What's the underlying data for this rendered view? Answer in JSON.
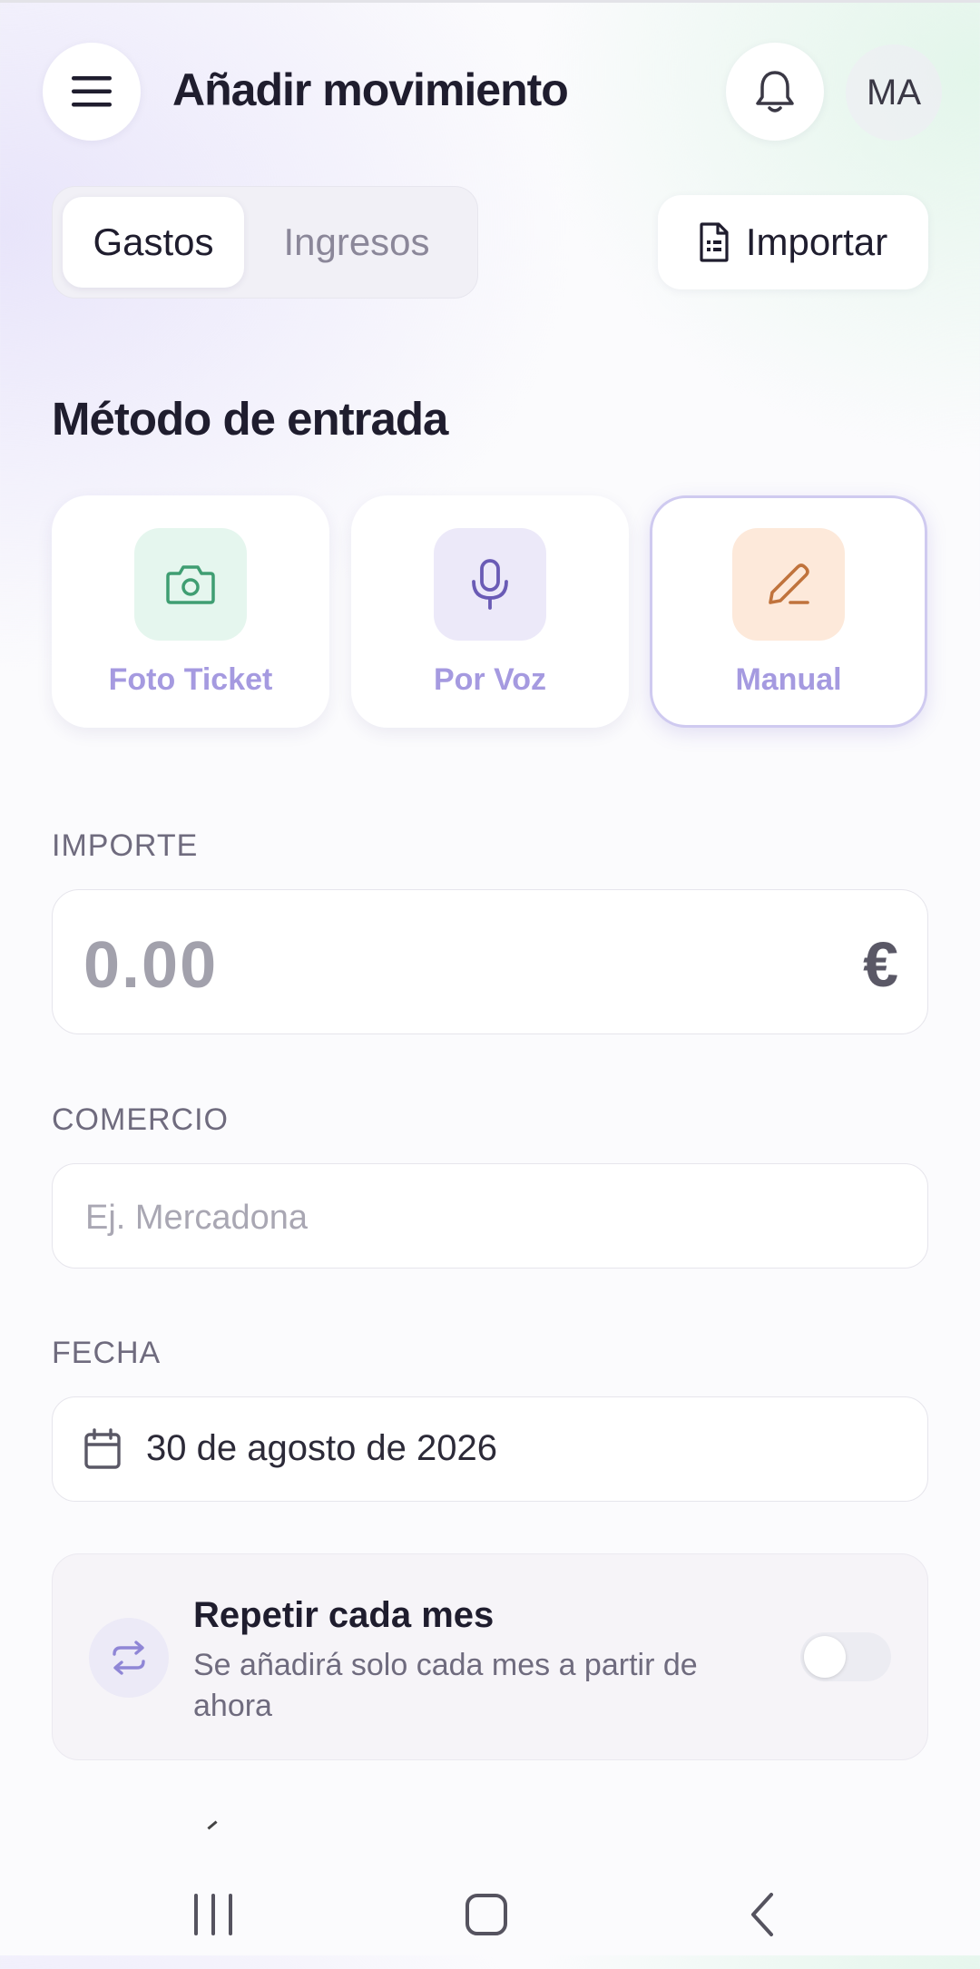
{
  "header": {
    "title": "Añadir movimiento",
    "avatar_initials": "MA",
    "menu_icon": "hamburger-menu-icon",
    "notification_icon": "bell-icon"
  },
  "type_toggle": {
    "options": [
      "Gastos",
      "Ingresos"
    ],
    "selected": "Gastos"
  },
  "import_button": {
    "label": "Importar",
    "icon": "document-icon"
  },
  "input_method": {
    "title": "Método de entrada",
    "options": [
      {
        "label": "Foto Ticket",
        "icon": "camera-icon",
        "icon_bg": "#e5f6ee",
        "icon_color": "#3f9e72"
      },
      {
        "label": "Por Voz",
        "icon": "microphone-icon",
        "icon_bg": "#ece9f9",
        "icon_color": "#6a5bb5"
      },
      {
        "label": "Manual",
        "icon": "pencil-icon",
        "icon_bg": "#fde9da",
        "icon_color": "#c0733c"
      }
    ],
    "selected": "Manual"
  },
  "amount": {
    "label": "IMPORTE",
    "placeholder": "0.00",
    "currency": "€"
  },
  "merchant": {
    "label": "COMERCIO",
    "placeholder": "Ej. Mercadona",
    "value": ""
  },
  "date": {
    "label": "FECHA",
    "value": "30 de agosto de 2026",
    "icon": "calendar-icon"
  },
  "repeat": {
    "title": "Repetir cada mes",
    "subtitle": "Se añadirá solo cada mes a partir de ahora",
    "enabled": false,
    "icon": "repeat-icon"
  },
  "system_nav": {
    "recents": "recents-icon",
    "home": "home-icon",
    "back": "back-icon"
  },
  "colors": {
    "accent": "#a59ae0",
    "text": "#1f1d2e",
    "muted": "#6f6b7e"
  }
}
